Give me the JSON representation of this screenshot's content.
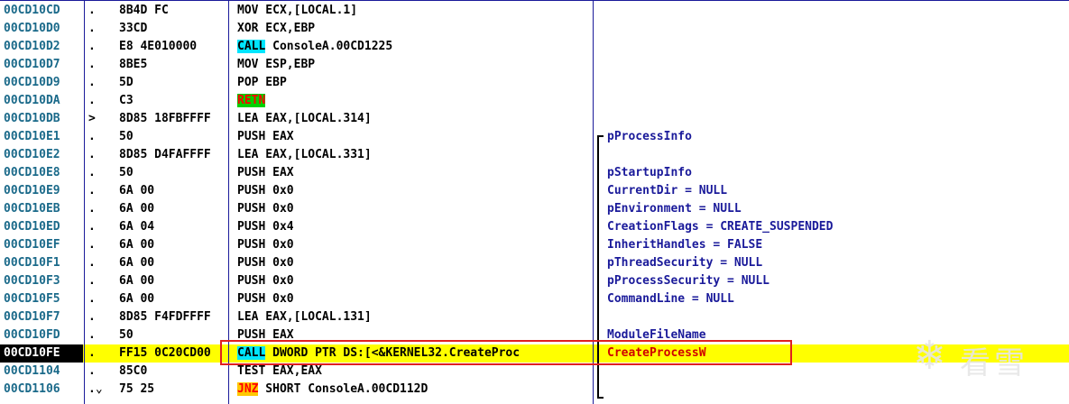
{
  "rows": [
    {
      "addr": "00CD10CD",
      "mark": ".",
      "hex": "8B4D FC",
      "mnem": "",
      "asm": "MOV ECX,[LOCAL.1]",
      "comment": ""
    },
    {
      "addr": "00CD10D0",
      "mark": ".",
      "hex": "33CD",
      "mnem": "",
      "asm": "XOR ECX,EBP",
      "comment": ""
    },
    {
      "addr": "00CD10D2",
      "mark": ".",
      "hex": "E8 4E010000",
      "mnem": "CALL",
      "asm": " ConsoleA.00CD1225",
      "comment": ""
    },
    {
      "addr": "00CD10D7",
      "mark": ".",
      "hex": "8BE5",
      "mnem": "",
      "asm": "MOV ESP,EBP",
      "comment": ""
    },
    {
      "addr": "00CD10D9",
      "mark": ".",
      "hex": "5D",
      "mnem": "",
      "asm": "POP EBP",
      "comment": ""
    },
    {
      "addr": "00CD10DA",
      "mark": ".",
      "hex": "C3",
      "mnem": "RETN",
      "asm": "",
      "comment": ""
    },
    {
      "addr": "00CD10DB",
      "mark": ">",
      "hex": "8D85 18FBFFFF",
      "mnem": "",
      "asm": "LEA EAX,[LOCAL.314]",
      "comment": ""
    },
    {
      "addr": "00CD10E1",
      "mark": ".",
      "hex": "50",
      "mnem": "",
      "asm": "PUSH EAX",
      "comment": "pProcessInfo"
    },
    {
      "addr": "00CD10E2",
      "mark": ".",
      "hex": "8D85 D4FAFFFF",
      "mnem": "",
      "asm": "LEA EAX,[LOCAL.331]",
      "comment": ""
    },
    {
      "addr": "00CD10E8",
      "mark": ".",
      "hex": "50",
      "mnem": "",
      "asm": "PUSH EAX",
      "comment": "pStartupInfo"
    },
    {
      "addr": "00CD10E9",
      "mark": ".",
      "hex": "6A 00",
      "mnem": "",
      "asm": "PUSH 0x0",
      "comment": "CurrentDir = NULL"
    },
    {
      "addr": "00CD10EB",
      "mark": ".",
      "hex": "6A 00",
      "mnem": "",
      "asm": "PUSH 0x0",
      "comment": "pEnvironment = NULL"
    },
    {
      "addr": "00CD10ED",
      "mark": ".",
      "hex": "6A 04",
      "mnem": "",
      "asm": "PUSH 0x4",
      "comment": "CreationFlags = CREATE_SUSPENDED"
    },
    {
      "addr": "00CD10EF",
      "mark": ".",
      "hex": "6A 00",
      "mnem": "",
      "asm": "PUSH 0x0",
      "comment": "InheritHandles = FALSE"
    },
    {
      "addr": "00CD10F1",
      "mark": ".",
      "hex": "6A 00",
      "mnem": "",
      "asm": "PUSH 0x0",
      "comment": "pThreadSecurity = NULL"
    },
    {
      "addr": "00CD10F3",
      "mark": ".",
      "hex": "6A 00",
      "mnem": "",
      "asm": "PUSH 0x0",
      "comment": "pProcessSecurity = NULL"
    },
    {
      "addr": "00CD10F5",
      "mark": ".",
      "hex": "6A 00",
      "mnem": "",
      "asm": "PUSH 0x0",
      "comment": "CommandLine = NULL"
    },
    {
      "addr": "00CD10F7",
      "mark": ".",
      "hex": "8D85 F4FDFFFF",
      "mnem": "",
      "asm": "LEA EAX,[LOCAL.131]",
      "comment": ""
    },
    {
      "addr": "00CD10FD",
      "mark": ".",
      "hex": "50",
      "mnem": "",
      "asm": "PUSH EAX",
      "comment": "ModuleFileName"
    },
    {
      "addr": "00CD10FE",
      "mark": ".",
      "hex": "FF15 0C20CD00",
      "mnem": "CALL",
      "asm": " DWORD PTR DS:[<&KERNEL32.CreateProc",
      "comment": "CreateProcessW"
    },
    {
      "addr": "00CD1104",
      "mark": ".",
      "hex": "85C0",
      "mnem": "",
      "asm": "TEST EAX,EAX",
      "comment": ""
    },
    {
      "addr": "00CD1106",
      "mark": ".⌄",
      "hex": "75 25",
      "mnem": "JNZ",
      "asm": " SHORT ConsoleA.00CD112D",
      "comment": ""
    }
  ],
  "watermark": {
    "icon": "❄",
    "text": "看雪"
  },
  "colors": {
    "selected_row": "#ffff00",
    "call_bg": "#00e5ff",
    "retn_bg": "#00d000",
    "jnz_bg": "#ffc800",
    "address": "#1b6a8a",
    "comment": "#1a1a9a",
    "highlight_box": "#e02020"
  }
}
